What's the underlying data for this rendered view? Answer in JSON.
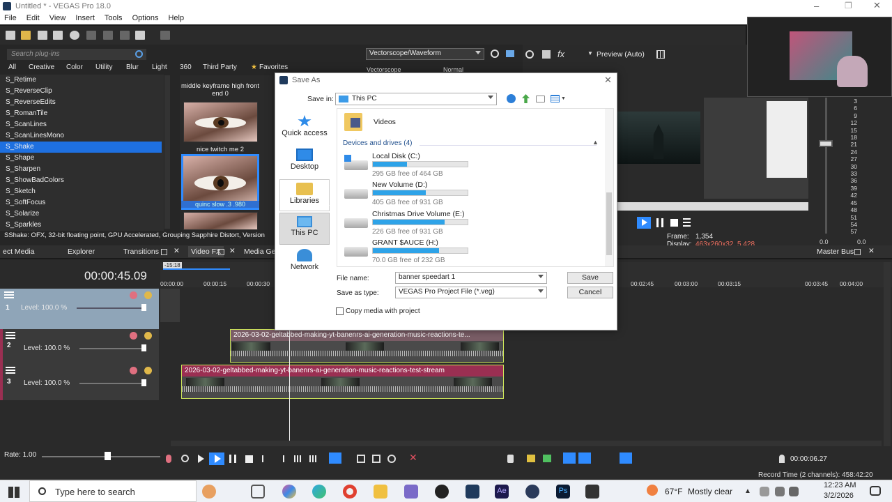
{
  "app": {
    "window_title": "Untitled * - VEGAS Pro 18.0",
    "menu": [
      "File",
      "Edit",
      "View",
      "Insert",
      "Tools",
      "Options",
      "Help"
    ]
  },
  "plugins": {
    "search_placeholder": "Search plug-ins",
    "categories": [
      "All",
      "Creative",
      "Color",
      "Utility",
      "Blur",
      "Light",
      "360",
      "Third Party",
      "Favorites"
    ],
    "list": [
      "S_Retime",
      "S_ReverseClip",
      "S_ReverseEdits",
      "S_RomanTile",
      "S_ScanLines",
      "S_ScanLinesMono",
      "S_Shake",
      "S_Shape",
      "S_Sharpen",
      "S_ShowBadColors",
      "S_Sketch",
      "S_SoftFocus",
      "S_Solarize",
      "S_Sparkles"
    ],
    "selected": "S_Shake",
    "presets": [
      {
        "label": "middle keyframe high front end 0"
      },
      {
        "label": "nice twitch me 2"
      },
      {
        "label": "quinc slow .3 .980"
      }
    ],
    "status": "SShake: OFX, 32-bit floating point, GPU Accelerated, Grouping  Sapphire Distort, Version"
  },
  "scopes": {
    "dropdown": "Vectorscope/Waveform",
    "sub_label": "Vectorscope",
    "mode": "Normal"
  },
  "preview": {
    "mode_label": "Preview (Auto)",
    "frame_label": "Frame:",
    "frame_value": "1,354",
    "display_label": "Display:",
    "display_value": "463x260x32, 5.428",
    "master_bus": "Master Bus"
  },
  "meters": {
    "ticks": [
      "3",
      "6",
      "9",
      "12",
      "15",
      "18",
      "21",
      "24",
      "27",
      "30",
      "33",
      "36",
      "39",
      "42",
      "45",
      "48",
      "51",
      "54",
      "57"
    ],
    "readout_l": "0.0",
    "readout_r": "0.0"
  },
  "tabs": [
    "ect Media",
    "Explorer",
    "Transitions",
    "Video FX",
    "Media Gen"
  ],
  "timeline": {
    "timecode": "00:00:45.09",
    "ruler_marker": "-15:18",
    "ruler_labels": [
      "00:00:00",
      "00:00:15",
      "00:00:30",
      "00:02:45",
      "00:03:00",
      "00:03:15",
      "00:03:45",
      "00:04:00"
    ],
    "tracks": [
      {
        "num": "1",
        "level": "Level: 100.0 %"
      },
      {
        "num": "2",
        "level": "Level: 100.0 %"
      },
      {
        "num": "3",
        "level": "Level: 100.0 %"
      }
    ],
    "clip_title": "2026-03-02-geltabbed-making-yt-banenrs-ai-generation-music-reactions-te...",
    "clip_title_full": "2026-03-02-geltabbed-making-yt-banenrs-ai-generation-music-reactions-test-stream"
  },
  "transport": {
    "rate": "Rate: 1.00",
    "time": "00:00:06.27",
    "record_time": "Record Time (2 channels): 458:42:20"
  },
  "dialog": {
    "title": "Save As",
    "save_in_label": "Save in:",
    "save_in_value": "This PC",
    "nav": [
      "Quick access",
      "Desktop",
      "Libraries",
      "This PC",
      "Network"
    ],
    "nav_selected": "This PC",
    "folder": "Videos",
    "devices_header": "Devices and drives (4)",
    "drives": [
      {
        "name": "Local Disk (C:)",
        "free": "295 GB free of 464 GB",
        "used_fraction": 0.36
      },
      {
        "name": "New Volume (D:)",
        "free": "405 GB free of 931 GB",
        "used_fraction": 0.56
      },
      {
        "name": "Christmas Drive Volume (E:)",
        "free": "226 GB free of 931 GB",
        "used_fraction": 0.76
      },
      {
        "name": "GRANT $AUCE (H:)",
        "free": "70.0 GB free of 232 GB",
        "used_fraction": 0.7
      }
    ],
    "file_name_label": "File name:",
    "file_name_value": "banner speedart 1",
    "save_type_label": "Save as type:",
    "save_type_value": "VEGAS Pro Project File (*.veg)",
    "save_button": "Save",
    "cancel_button": "Cancel",
    "copy_media_label": "Copy media with project"
  },
  "taskbar": {
    "search_placeholder": "Type here to search",
    "weather_temp": "67°F",
    "weather_text": "Mostly clear",
    "time": "12:23 AM",
    "date": "3/2/2026"
  },
  "colors": {
    "accent": "#1e70e0",
    "drive_bar": "#2ea3e8",
    "clip_border": "#cde55a",
    "clip_header_1": "#7a5d66",
    "clip_header_2": "#9a2f52"
  }
}
